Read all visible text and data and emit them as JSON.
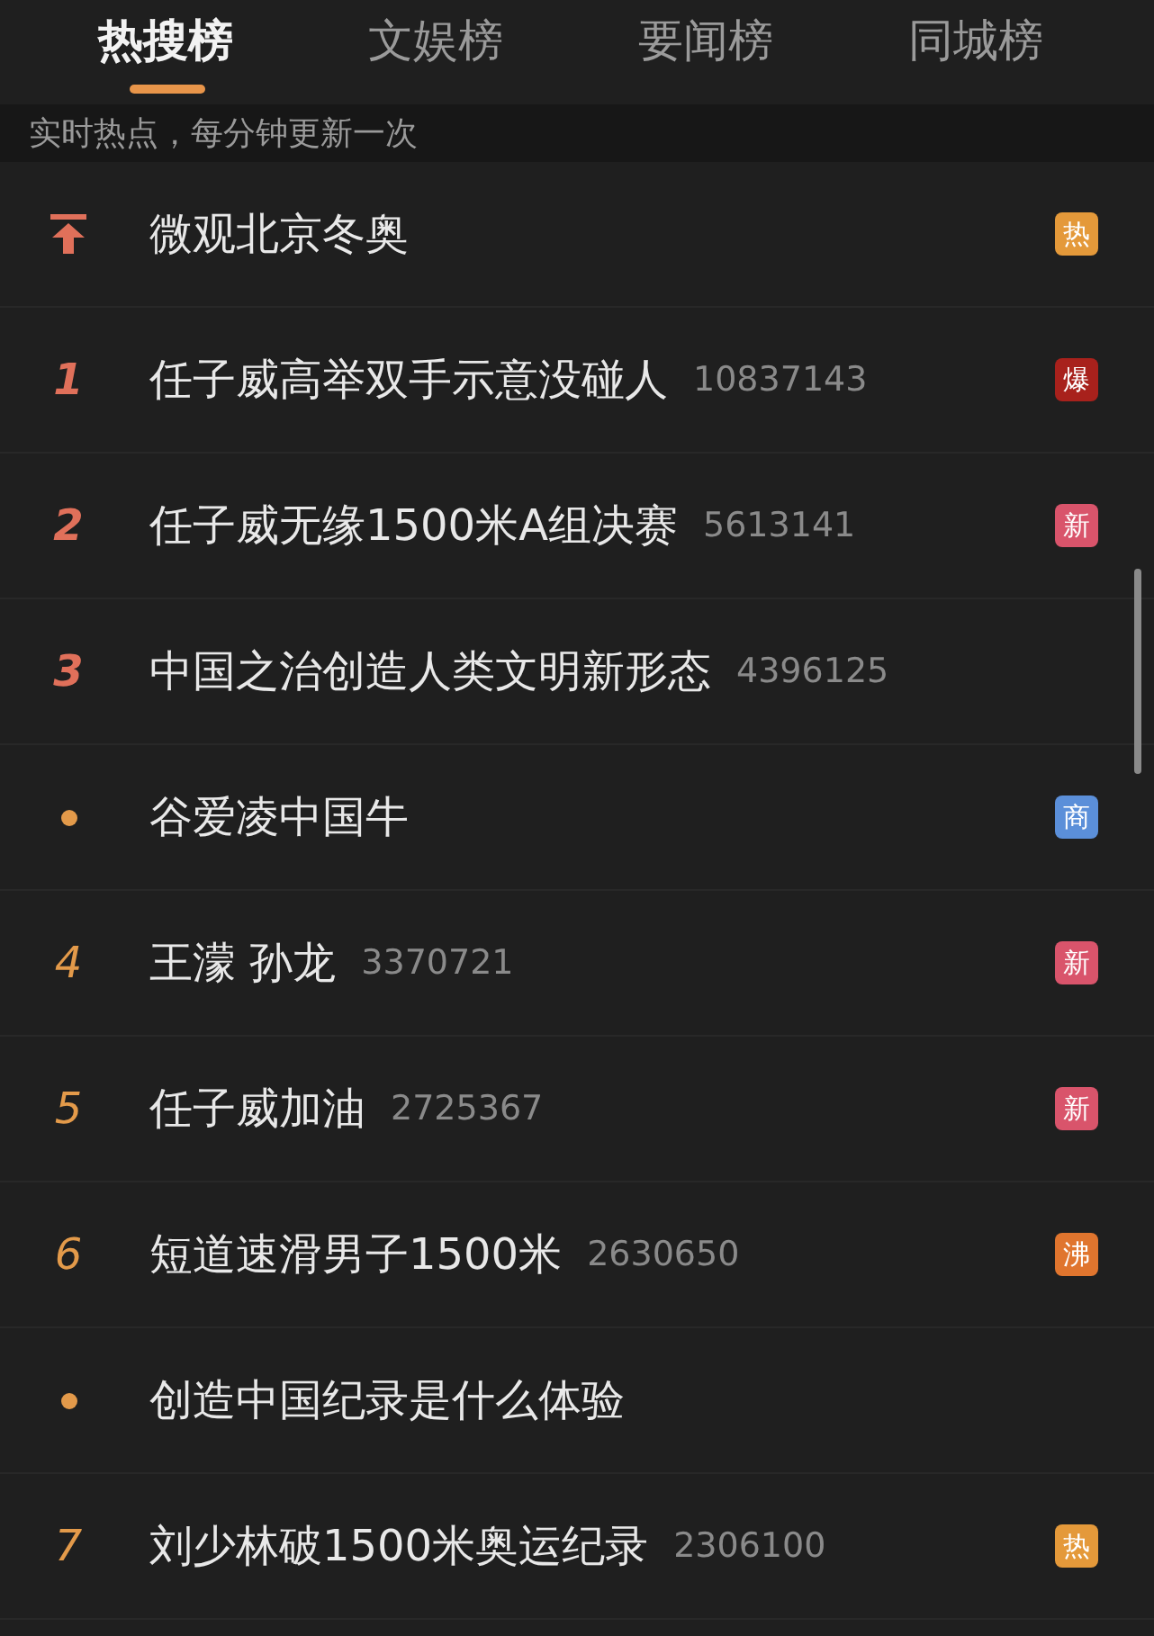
{
  "tabs": [
    {
      "label": "热搜榜",
      "selected": true
    },
    {
      "label": "文娱榜",
      "selected": false
    },
    {
      "label": "要闻榜",
      "selected": false
    },
    {
      "label": "同城榜",
      "selected": false
    }
  ],
  "subtitle": "实时热点，每分钟更新一次",
  "rows": [
    {
      "kind": "pin",
      "title": "微观北京冬奥",
      "badge": {
        "label": "热",
        "color": "#e4993a"
      }
    },
    {
      "kind": "top",
      "rank": "1",
      "title": "任子威高举双手示意没碰人",
      "count": "10837143",
      "badge": {
        "label": "爆",
        "color": "#a8211c"
      }
    },
    {
      "kind": "top",
      "rank": "2",
      "title": "任子威无缘1500米A组决赛",
      "count": "5613141",
      "badge": {
        "label": "新",
        "color": "#d9546b"
      }
    },
    {
      "kind": "top",
      "rank": "3",
      "title": "中国之治创造人类文明新形态",
      "count": "4396125"
    },
    {
      "kind": "dot",
      "title": "谷爱凌中国牛",
      "badge": {
        "label": "商",
        "color": "#5b8fd9"
      }
    },
    {
      "kind": "rank",
      "rank": "4",
      "title": "王濛 孙龙",
      "count": "3370721",
      "badge": {
        "label": "新",
        "color": "#d9546b"
      }
    },
    {
      "kind": "rank",
      "rank": "5",
      "title": "任子威加油",
      "count": "2725367",
      "badge": {
        "label": "新",
        "color": "#d9546b"
      }
    },
    {
      "kind": "rank",
      "rank": "6",
      "title": "短道速滑男子1500米",
      "count": "2630650",
      "badge": {
        "label": "沸",
        "color": "#e0752e"
      }
    },
    {
      "kind": "dot",
      "title": "创造中国纪录是什么体验"
    },
    {
      "kind": "rank",
      "rank": "7",
      "title": "刘少林破1500米奥运纪录",
      "count": "2306100",
      "badge": {
        "label": "热",
        "color": "#e4993a"
      }
    }
  ]
}
